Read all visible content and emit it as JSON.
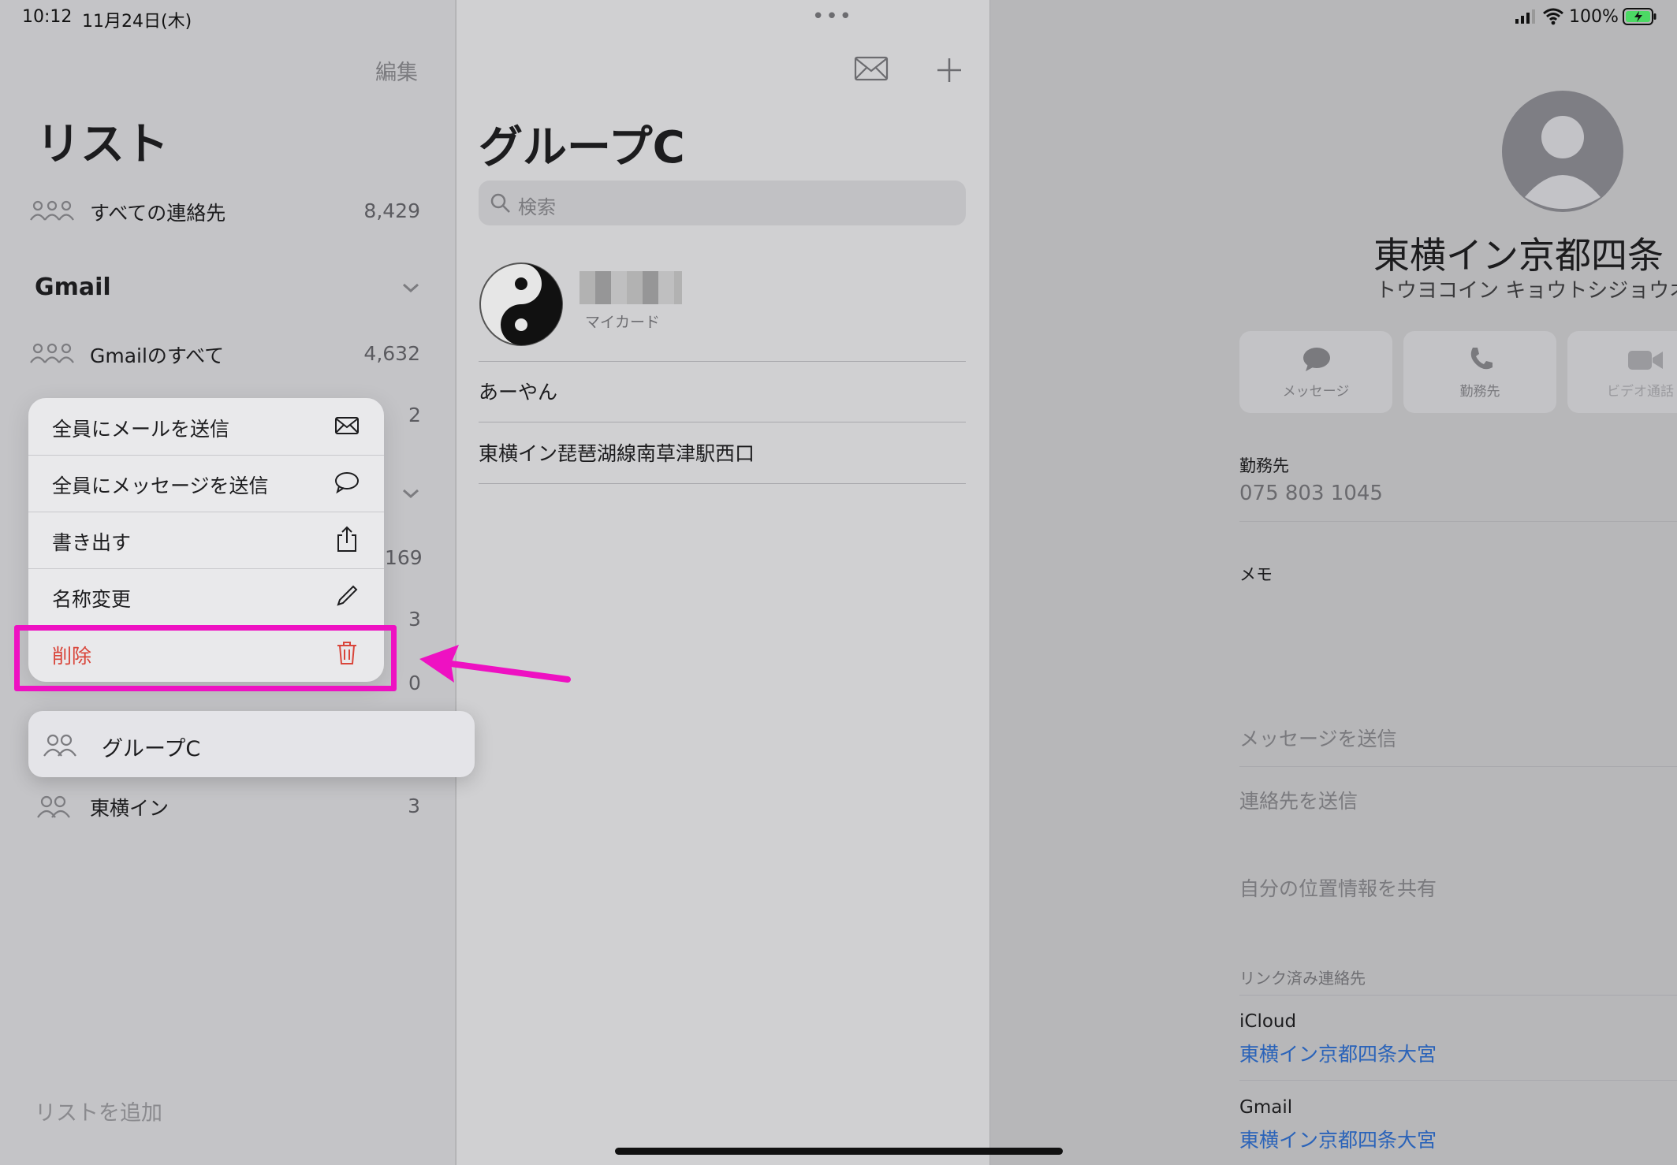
{
  "status_bar": {
    "time": "10:12",
    "date": "11月24日(木)",
    "battery": "100%"
  },
  "left_panel": {
    "edit_label": "編集",
    "title": "リスト",
    "all_contacts": {
      "label": "すべての連絡先",
      "count": "8,429"
    },
    "gmail_section": {
      "title": "Gmail"
    },
    "gmail_all": {
      "label": "Gmailのすべて",
      "count": "4,632"
    },
    "hidden_counts": [
      "2",
      "169",
      "3",
      "0"
    ],
    "selected_group": {
      "label": "グループC"
    },
    "toyoko_group": {
      "label": "東横イン",
      "count": "3"
    },
    "add_list_label": "リストを追加"
  },
  "context_menu": {
    "items": [
      {
        "label": "全員にメールを送信",
        "icon": "envelope-icon"
      },
      {
        "label": "全員にメッセージを送信",
        "icon": "speech-bubble-icon"
      },
      {
        "label": "書き出す",
        "icon": "share-icon"
      },
      {
        "label": "名称変更",
        "icon": "pencil-icon"
      },
      {
        "label": "削除",
        "icon": "trash-icon",
        "color": "#d9453a"
      }
    ],
    "highlight_color": "#ee11c2"
  },
  "middle_panel": {
    "title": "グループC",
    "search_placeholder": "検索",
    "my_card_label": "マイカード",
    "contacts": [
      "あーやん",
      "東横イン琵琶湖線南草津駅西口"
    ]
  },
  "right_panel": {
    "name": "東横イン京都四条",
    "phonetic": "トウヨコイン キョウトシジョウオ",
    "actions": [
      {
        "label": "メッセージ",
        "icon": "message-icon"
      },
      {
        "label": "勤務先",
        "icon": "phone-icon"
      },
      {
        "label": "ビデオ通話",
        "icon": "video-icon"
      }
    ],
    "work_label": "勤務先",
    "work_phone": "075 803 1045",
    "memo_label": "メモ",
    "send_message": "メッセージを送信",
    "send_contact": "連絡先を送信",
    "share_location": "自分の位置情報を共有",
    "linked_contacts_header": "リンク済み連絡先",
    "linked": [
      {
        "source": "iCloud",
        "name": "東横イン京都四条大宮"
      },
      {
        "source": "Gmail",
        "name": "東横イン京都四条大宮"
      }
    ]
  }
}
